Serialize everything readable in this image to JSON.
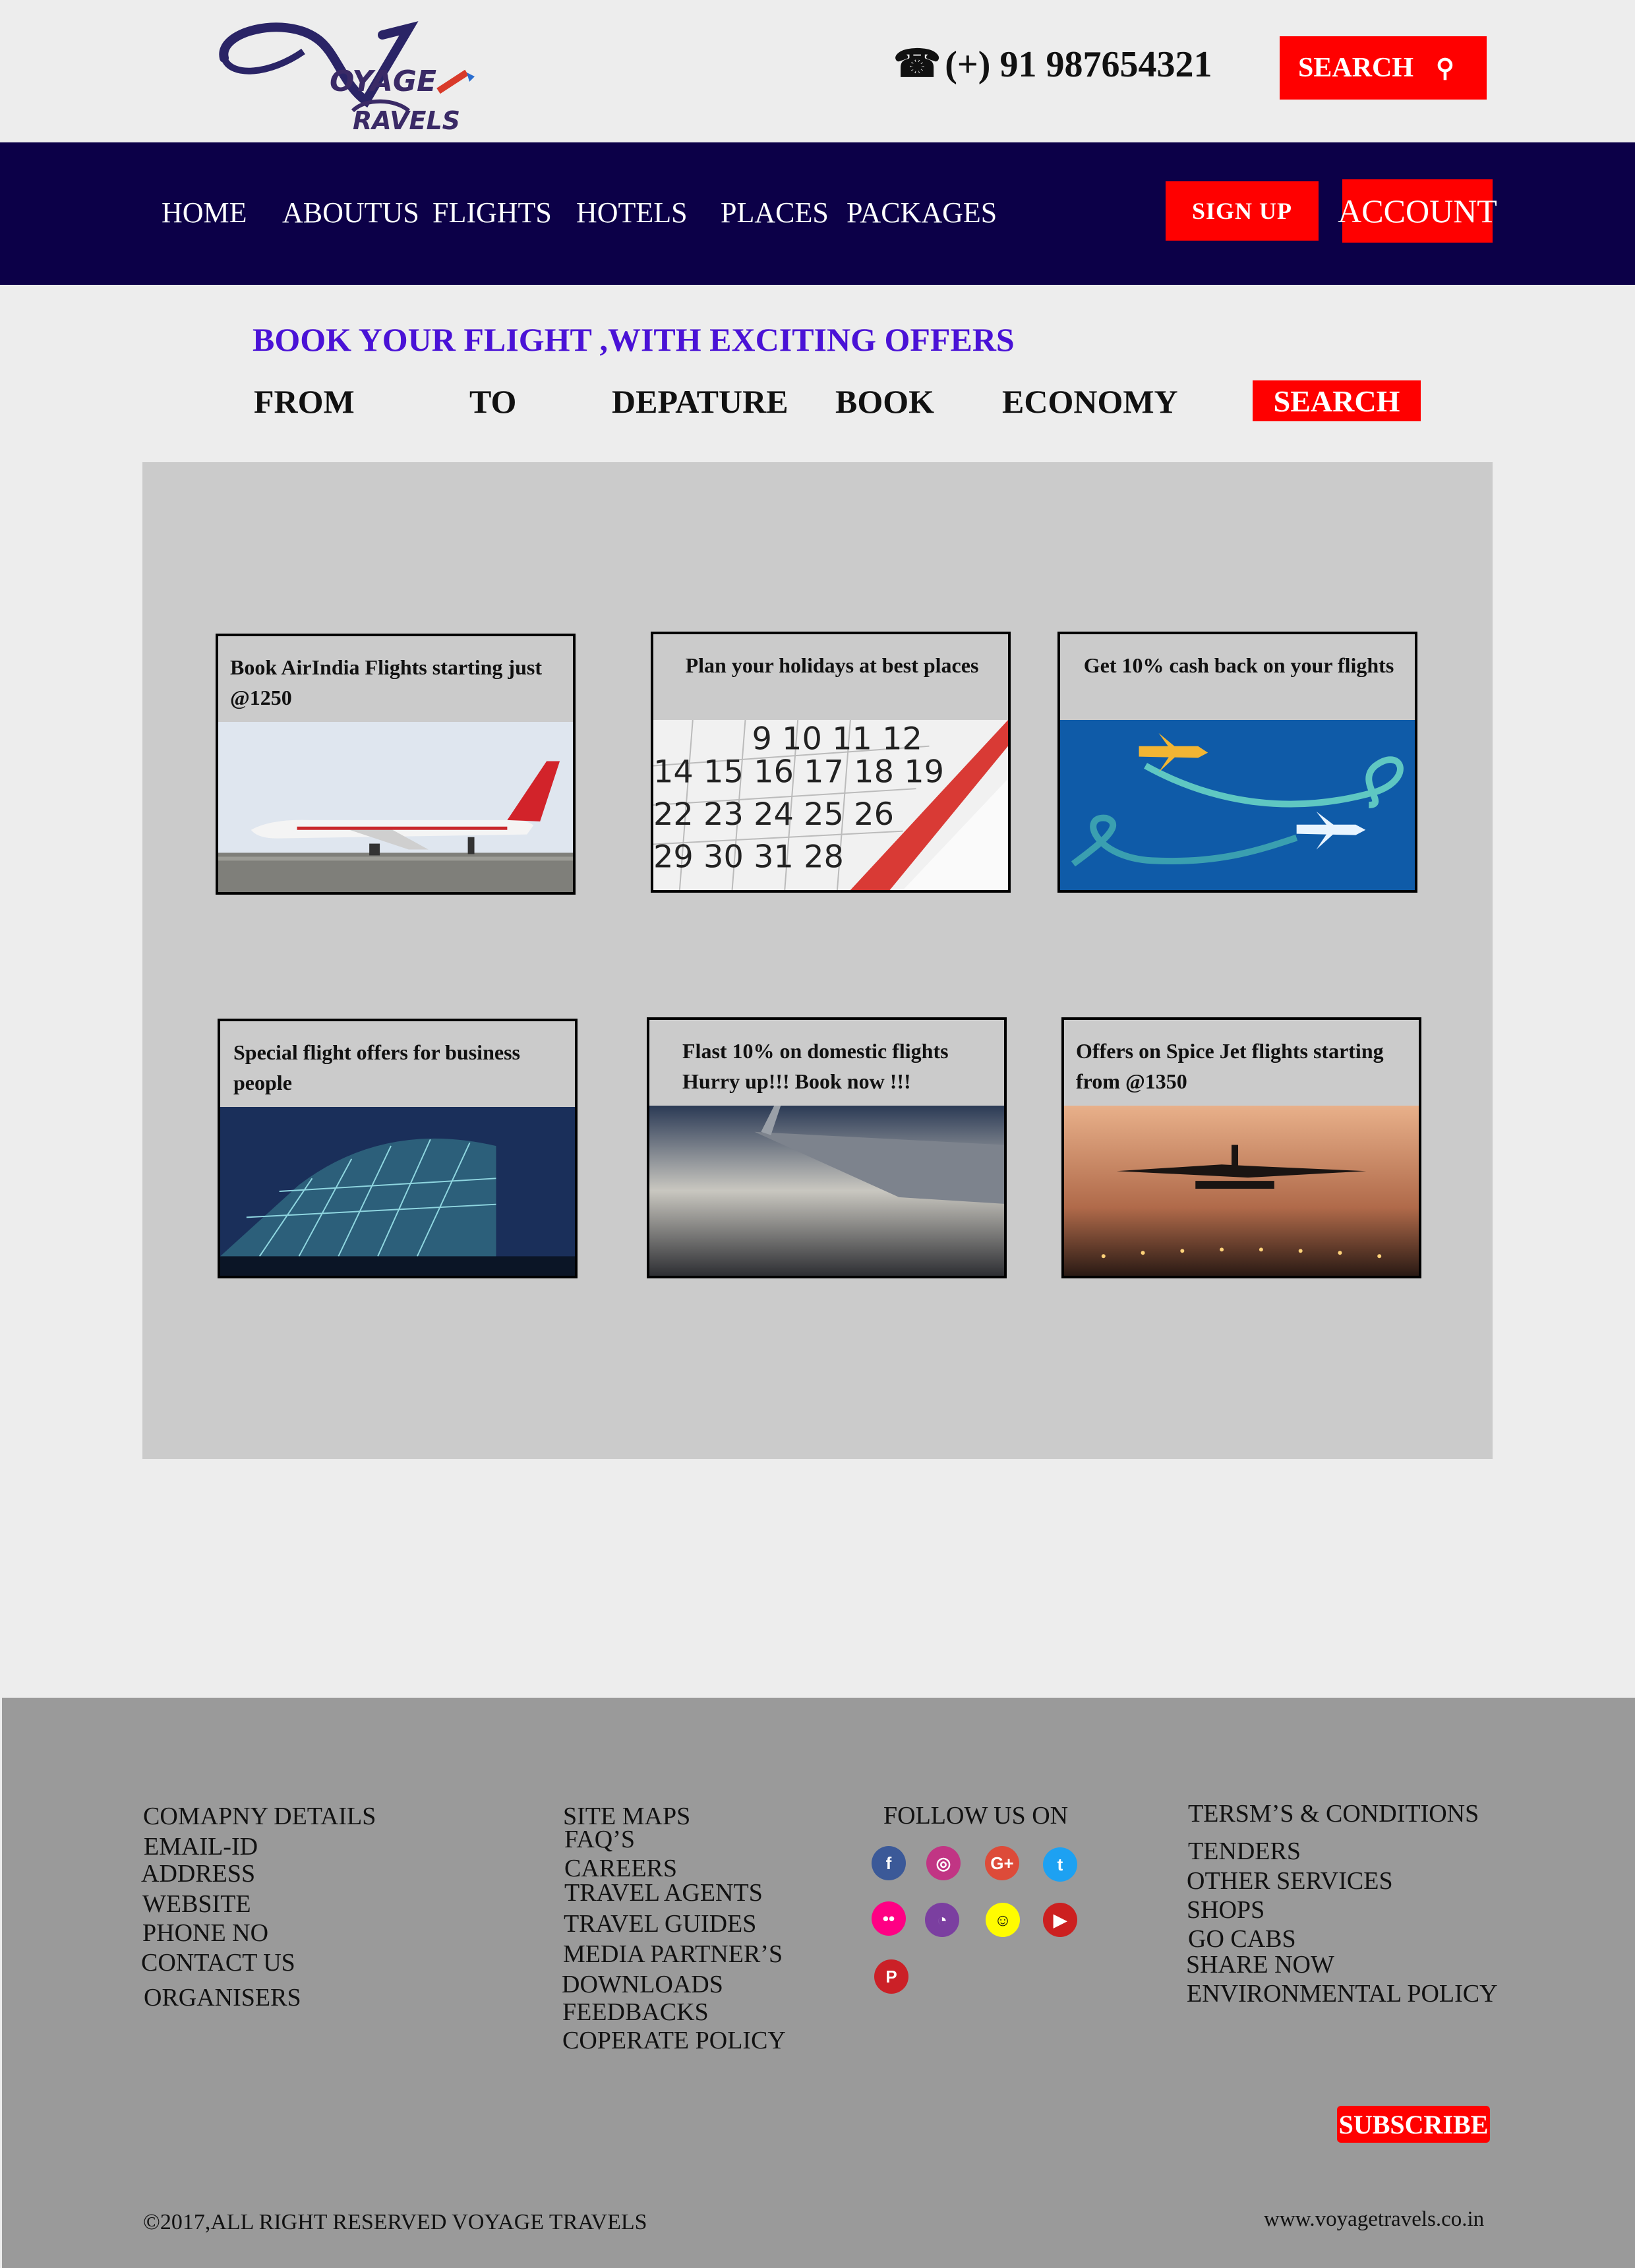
{
  "header": {
    "logo_line1": "OYAGE",
    "logo_line2": "RAVELS",
    "phone": "(+) 91 987654321",
    "search_label": "SEARCH",
    "icons": [
      "phone-icon",
      "magnifier-icon"
    ]
  },
  "nav": {
    "items": [
      "HOME",
      "ABOUTUS",
      "FLIGHTS",
      "HOTELS",
      "PLACES",
      "PACKAGES"
    ],
    "signup_label": "SIGN UP",
    "account_label": "ACCOUNT"
  },
  "booking": {
    "title": "BOOK YOUR FLIGHT ,WITH EXCITING OFFERS",
    "fields": [
      "FROM",
      "TO",
      "DEPATURE",
      "BOOK",
      "ECONOMY"
    ],
    "search_label": "SEARCH"
  },
  "offers": [
    {
      "caption": "Book AirIndia Flights starting just @1250",
      "image": "airindia-plane-image"
    },
    {
      "caption": "Plan your holidays at best places",
      "image": "calendar-image"
    },
    {
      "caption": "Get 10% cash back on your flights",
      "image": "planes-illustration-image"
    },
    {
      "caption": "Special flight offers for business people",
      "image": "airport-terminal-image"
    },
    {
      "caption": "Flast 10% on domestic flights Hurry up!!! Book now !!!",
      "image": "airplane-wing-image"
    },
    {
      "caption": "Offers on Spice Jet flights starting from @1350",
      "image": "plane-landing-image"
    }
  ],
  "footer": {
    "company": [
      "COMAPNY DETAILS",
      "EMAIL-ID",
      "ADDRESS",
      "WEBSITE",
      "PHONE NO",
      "CONTACT US",
      "ORGANISERS"
    ],
    "links": [
      "SITE MAPS",
      "FAQ’S",
      "CAREERS",
      "TRAVEL AGENTS",
      "TRAVEL GUIDES",
      "MEDIA PARTNER’S",
      "DOWNLOADS",
      "FEEDBACKS",
      "COPERATE POLICY"
    ],
    "follow_title": "FOLLOW US ON",
    "social": [
      {
        "name": "facebook-icon",
        "glyph": "f",
        "color": "#3b5998"
      },
      {
        "name": "instagram-icon",
        "glyph": "◎",
        "color": "#c13584"
      },
      {
        "name": "google-plus-icon",
        "glyph": "G+",
        "color": "#dd4b39"
      },
      {
        "name": "twitter-icon",
        "glyph": "t",
        "color": "#1da1f2"
      },
      {
        "name": "flickr-icon",
        "glyph": "••",
        "color": "#ff0084"
      },
      {
        "name": "picasa-icon",
        "glyph": "◔",
        "color": "#7b3fa0"
      },
      {
        "name": "snapchat-icon",
        "glyph": "☺",
        "color": "#fffc00"
      },
      {
        "name": "youtube-icon",
        "glyph": "▶",
        "color": "#cc2020"
      },
      {
        "name": "pinterest-icon",
        "glyph": "P",
        "color": "#cb2027"
      }
    ],
    "policies": [
      "TERSM’S & CONDITIONS",
      "TENDERS",
      "OTHER SERVICES",
      "SHOPS",
      "GO CABS",
      "SHARE NOW",
      "ENVIRONMENTAL POLICY"
    ],
    "subscribe_label": "SUBSCRIBE",
    "copyright": "2017,ALL RIGHT RESERVED VOYAGE TRAVELS",
    "website": "www.voyagetravels.co.in"
  }
}
